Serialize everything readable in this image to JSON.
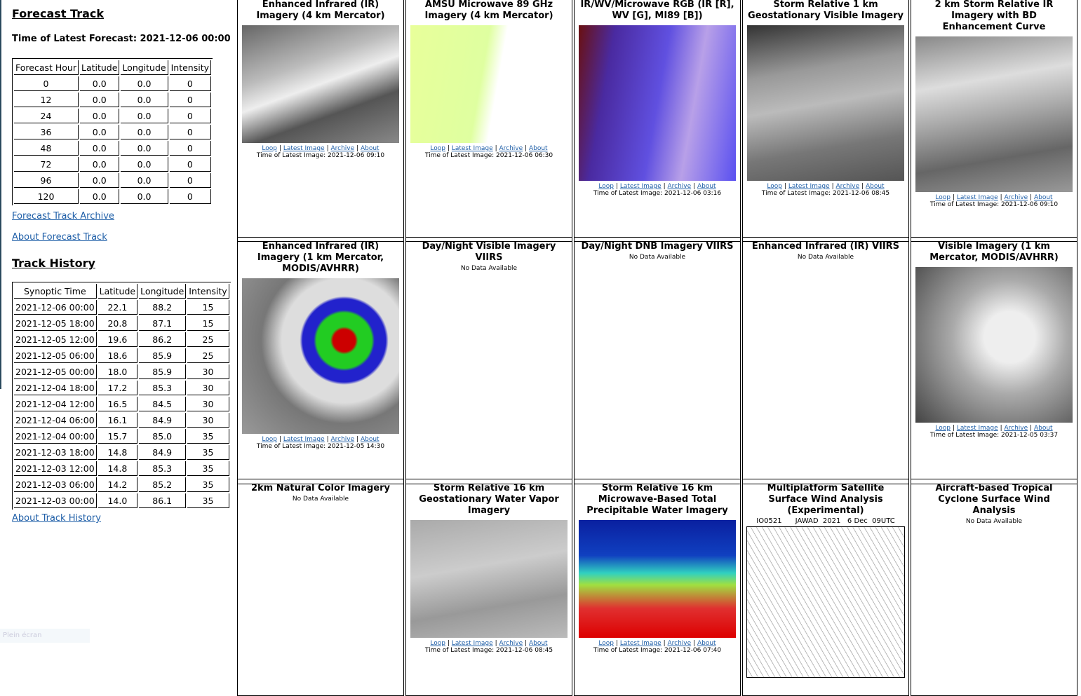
{
  "forecast": {
    "title": "Forecast Track",
    "time_label": "Time of Latest Forecast: 2021-12-06 00:00",
    "headers": [
      "Forecast Hour",
      "Latitude",
      "Longitude",
      "Intensity"
    ],
    "rows": [
      [
        "0",
        "0.0",
        "0.0",
        "0"
      ],
      [
        "12",
        "0.0",
        "0.0",
        "0"
      ],
      [
        "24",
        "0.0",
        "0.0",
        "0"
      ],
      [
        "36",
        "0.0",
        "0.0",
        "0"
      ],
      [
        "48",
        "0.0",
        "0.0",
        "0"
      ],
      [
        "72",
        "0.0",
        "0.0",
        "0"
      ],
      [
        "96",
        "0.0",
        "0.0",
        "0"
      ],
      [
        "120",
        "0.0",
        "0.0",
        "0"
      ]
    ],
    "archive_link": "Forecast Track Archive",
    "about_link": "About Forecast Track"
  },
  "history": {
    "title": "Track History",
    "headers": [
      "Synoptic Time",
      "Latitude",
      "Longitude",
      "Intensity"
    ],
    "rows": [
      [
        "2021-12-06 00:00",
        "22.1",
        "88.2",
        "15"
      ],
      [
        "2021-12-05 18:00",
        "20.8",
        "87.1",
        "15"
      ],
      [
        "2021-12-05 12:00",
        "19.6",
        "86.2",
        "25"
      ],
      [
        "2021-12-05 06:00",
        "18.6",
        "85.9",
        "25"
      ],
      [
        "2021-12-05 00:00",
        "18.0",
        "85.9",
        "30"
      ],
      [
        "2021-12-04 18:00",
        "17.2",
        "85.3",
        "30"
      ],
      [
        "2021-12-04 12:00",
        "16.5",
        "84.5",
        "30"
      ],
      [
        "2021-12-04 06:00",
        "16.1",
        "84.9",
        "30"
      ],
      [
        "2021-12-04 00:00",
        "15.7",
        "85.0",
        "35"
      ],
      [
        "2021-12-03 18:00",
        "14.8",
        "84.9",
        "35"
      ],
      [
        "2021-12-03 12:00",
        "14.8",
        "85.3",
        "35"
      ],
      [
        "2021-12-03 06:00",
        "14.2",
        "85.2",
        "35"
      ],
      [
        "2021-12-03 00:00",
        "14.0",
        "86.1",
        "35"
      ]
    ],
    "about_link": "About Track History"
  },
  "fullscreen_label": "Plein écran",
  "links": {
    "loop": "Loop",
    "latest": "Latest Image",
    "archive": "Archive",
    "about": "About",
    "sep": "|"
  },
  "products": [
    {
      "title": "Enhanced Infrared (IR) Imagery (4 km Mercator)",
      "time": "Time of Latest Image: 2021-12-06 09:10",
      "bg": "linear-gradient(160deg,#666 0%,#bbb 35%,#eee 50%,#555 70%,#888 100%)"
    },
    {
      "title": "AMSU Microwave 89 GHz Imagery (4 km Mercator)",
      "time": "Time of Latest Image: 2021-12-06 06:30",
      "bg": "linear-gradient(100deg,#e8ff9a 0%,#dfffa0 45%,#ffffff 55%,#fff 100%)"
    },
    {
      "title": "IR/WV/Microwave RGB (IR [R], WV [G], MI89 [B])",
      "time": "Time of Latest Image: 2021-12-06 03:16",
      "bg": "linear-gradient(100deg,#6a1010 0%,#4a2aa0 20%,#6050e0 50%,#b8a0e8 70%,#5a50f0 100%)"
    },
    {
      "title": "Storm Relative 1 km Geostationary Visible Imagery",
      "time": "Time of Latest Image: 2021-12-06 08:45",
      "bg": "linear-gradient(170deg,#333 0%,#999 30%,#bbb 50%,#777 75%,#555 100%)"
    },
    {
      "title": "2 km Storm Relative IR Imagery with BD Enhancement Curve",
      "time": "Time of Latest Image: 2021-12-06 09:10",
      "bg": "linear-gradient(170deg,#888 0%,#ddd 30%,#aaa 50%,#666 75%,#999 100%)"
    },
    {
      "title": "Enhanced Infrared (IR) Imagery (1 km Mercator, MODIS/AVHRR)",
      "time": "Time of Latest Image: 2021-12-05 14:30",
      "bg": "radial-gradient(circle at 65% 40%,#c00 0 8%,#2c2 10% 20%,#22c 22% 30%,#ddd 32% 45%,#777 60%,#999 100%)"
    },
    {
      "title": "Day/Night Visible Imagery VIIRS",
      "nodata": "No Data Available"
    },
    {
      "title": "Day/Night DNB Imagery VIIRS",
      "nodata": "No Data Available"
    },
    {
      "title": "Enhanced Infrared (IR) VIIRS",
      "nodata": "No Data Available"
    },
    {
      "title": "Visible Imagery (1 km Mercator, MODIS/AVHRR)",
      "time": "Time of Latest Image: 2021-12-05 03:37",
      "bg": "radial-gradient(circle at 60% 45%,#eee 0 20%,#aaa 45%,#444 100%)"
    },
    {
      "title": "2km Natural Color Imagery",
      "nodata": "No Data Available"
    },
    {
      "title": "Storm Relative 16 km Geostationary Water Vapor Imagery",
      "time": "Time of Latest Image: 2021-12-06 08:45",
      "bg": "linear-gradient(170deg,#aaa 0%,#ccc 40%,#999 70%,#bbb 100%)"
    },
    {
      "title": "Storm Relative 16 km Microwave-Based Total Precipitable Water Imagery",
      "time": "Time of Latest Image: 2021-12-06 07:40",
      "bg": "linear-gradient(180deg,#0a20a0 0%,#1040c0 30%,#30d0c0 45%,#a0e040 55%,#e03030 75%,#d00 100%)"
    },
    {
      "title": "Multiplatform Satellite Surface Wind Analysis (Experimental)",
      "caption": "IO0521      JAWAD  2021   6 Dec  09UTC",
      "bg": "repeating-linear-gradient(60deg,#fff 0 6px,#bbb 6px 7px)"
    },
    {
      "title": "Aircraft-based Tropical Cyclone Surface Wind Analysis",
      "nodata": "No Data Available"
    }
  ]
}
